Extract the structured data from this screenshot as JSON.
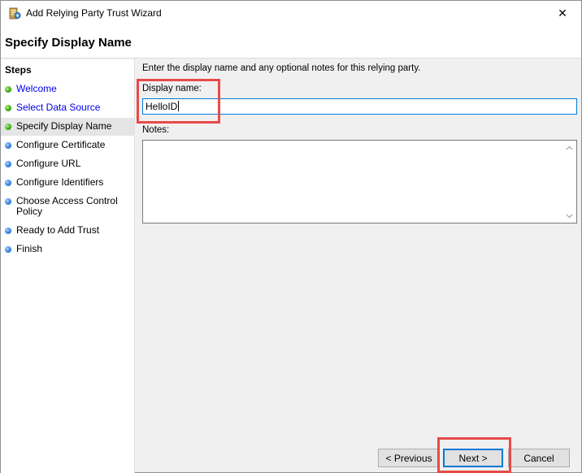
{
  "window": {
    "title": "Add Relying Party Trust Wizard",
    "close_glyph": "✕"
  },
  "header": {
    "title": "Specify Display Name"
  },
  "steps": {
    "title": "Steps",
    "items": [
      {
        "label": "Welcome",
        "state": "done"
      },
      {
        "label": "Select Data Source",
        "state": "done"
      },
      {
        "label": "Specify Display Name",
        "state": "current"
      },
      {
        "label": "Configure Certificate",
        "state": "pending"
      },
      {
        "label": "Configure URL",
        "state": "pending"
      },
      {
        "label": "Configure Identifiers",
        "state": "pending"
      },
      {
        "label": "Choose Access Control Policy",
        "state": "pending"
      },
      {
        "label": "Ready to Add Trust",
        "state": "pending"
      },
      {
        "label": "Finish",
        "state": "pending"
      }
    ]
  },
  "form": {
    "intro": "Enter the display name and any optional notes for this relying party.",
    "display_name_label": "Display name:",
    "display_name_value": "HelloID",
    "notes_label": "Notes:",
    "notes_value": ""
  },
  "buttons": {
    "previous": "< Previous",
    "next": "Next >",
    "cancel": "Cancel"
  },
  "colors": {
    "highlight": "#e84a4a",
    "focus": "#0078d7",
    "step_done": "#38a80f",
    "step_pending": "#2f7fe0",
    "link": "#0000ee"
  }
}
